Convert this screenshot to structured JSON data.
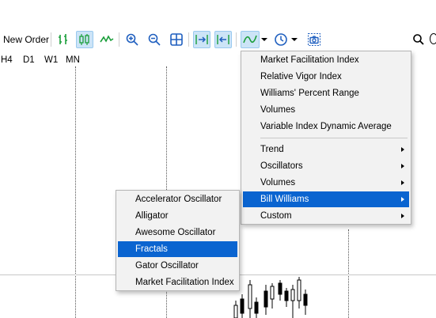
{
  "toolbar": {
    "new_order_label": "New Order",
    "icons": [
      "bar-chart-icon",
      "candlestick-icon",
      "line-chart-icon",
      "zoom-in-icon",
      "zoom-out-icon",
      "tile-windows-icon",
      "auto-scroll-icon",
      "chart-shift-icon",
      "indicators-icon",
      "clock-icon",
      "screenshot-icon",
      "search-icon"
    ]
  },
  "timeframes": [
    "H4",
    "D1",
    "W1",
    "MN"
  ],
  "indicators_menu": {
    "items": [
      {
        "label": "Market Facilitation Index"
      },
      {
        "label": "Relative Vigor Index"
      },
      {
        "label": "Williams' Percent Range"
      },
      {
        "label": "Volumes"
      },
      {
        "label": "Variable Index Dynamic Average"
      },
      {
        "label": "Trend"
      },
      {
        "label": "Oscillators"
      },
      {
        "label": "Volumes"
      },
      {
        "label": "Bill Williams"
      },
      {
        "label": "Custom"
      }
    ]
  },
  "bill_williams_submenu": {
    "items": [
      {
        "label": "Accelerator Oscillator"
      },
      {
        "label": "Alligator"
      },
      {
        "label": "Awesome Oscillator"
      },
      {
        "label": "Fractals"
      },
      {
        "label": "Gator Oscillator"
      },
      {
        "label": "Market Facilitation Index"
      }
    ]
  },
  "colors": {
    "highlight": "#0a64d0",
    "menu_bg": "#f2f2f2",
    "toolbar_green": "#1a9e3a",
    "toolbar_blue": "#1f5fbf"
  }
}
